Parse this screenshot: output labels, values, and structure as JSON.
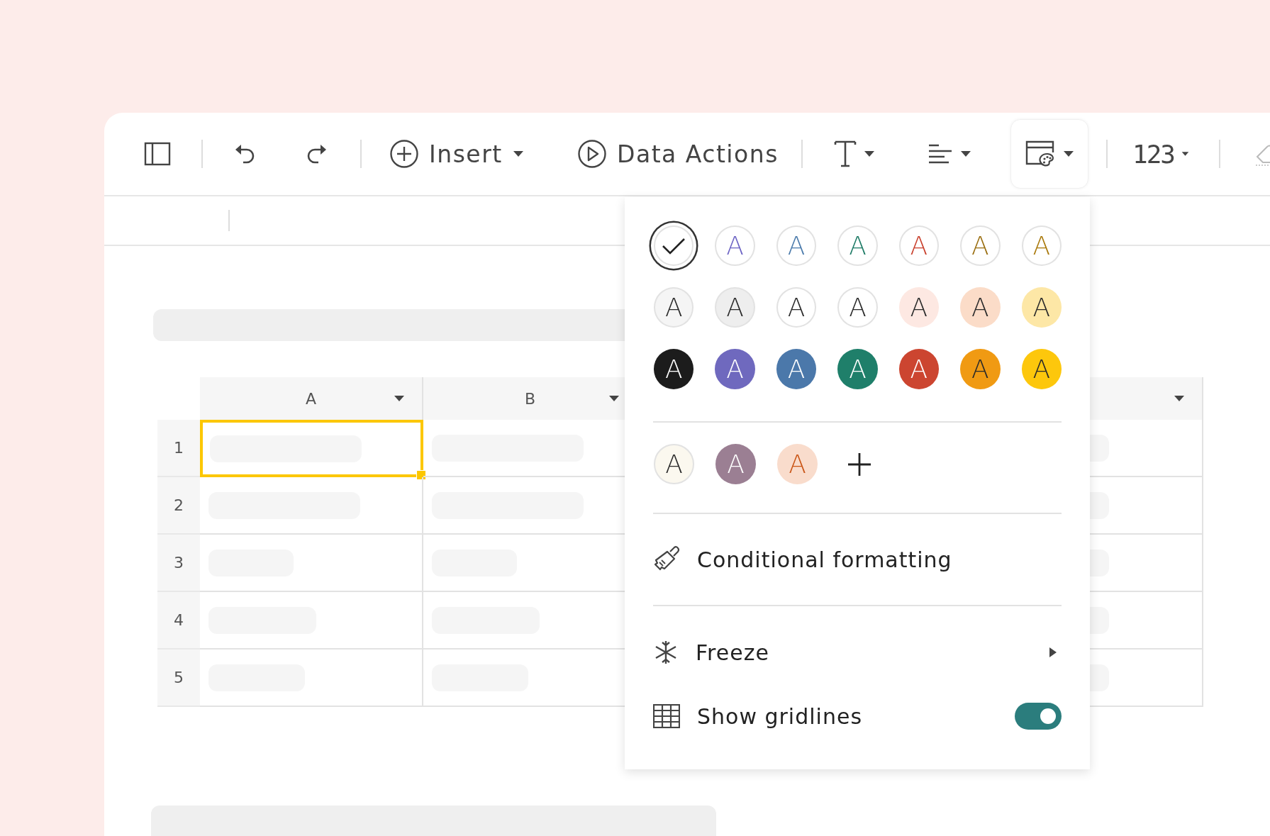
{
  "toolbar": {
    "insert": "Insert",
    "data_actions": "Data Actions",
    "number_format": "123",
    "format_button_selected": true
  },
  "table": {
    "columns": [
      {
        "label": "A"
      },
      {
        "label": "B"
      }
    ],
    "rows": [
      {
        "label": "1",
        "cells": [
          {
            "selected": true
          },
          {
            "selected": false
          },
          {
            "selected": false
          }
        ]
      },
      {
        "label": "2",
        "cells": [
          {
            "selected": false
          },
          {
            "selected": false
          },
          {
            "selected": false
          }
        ]
      },
      {
        "label": "3",
        "cells": [
          {
            "selected": false
          },
          {
            "selected": false
          },
          {
            "selected": false
          }
        ]
      },
      {
        "label": "4",
        "cells": [
          {
            "selected": false
          },
          {
            "selected": false
          },
          {
            "selected": false
          }
        ]
      },
      {
        "label": "5",
        "cells": [
          {
            "selected": false
          },
          {
            "selected": false
          },
          {
            "selected": false
          }
        ]
      }
    ]
  },
  "format_menu": {
    "swatch_rows": [
      [
        {
          "kind": "default",
          "selected": true
        },
        {
          "kind": "outline",
          "label": "A",
          "selected": false,
          "color": "#6c63c4"
        },
        {
          "kind": "outline",
          "label": "A",
          "selected": false,
          "color": "#4a7aab"
        },
        {
          "kind": "outline",
          "label": "A",
          "selected": false,
          "color": "#1e7b66"
        },
        {
          "kind": "outline",
          "label": "A",
          "selected": false,
          "color": "#c9402d"
        },
        {
          "kind": "outline",
          "label": "A",
          "selected": false,
          "color": "#9a6e10"
        },
        {
          "kind": "outline",
          "label": "A",
          "selected": false,
          "color": "#a9780a"
        }
      ],
      [
        {
          "kind": "filled",
          "label": "A",
          "selected": false,
          "color": "#f5f5f5",
          "light_letter": false
        },
        {
          "kind": "filled",
          "label": "A",
          "selected": false,
          "color": "#eeeeee",
          "light_letter": false
        },
        {
          "kind": "filled",
          "label": "A",
          "selected": false,
          "color": "#ffffff",
          "light_letter": false
        },
        {
          "kind": "filled",
          "label": "A",
          "selected": false,
          "color": "#ffffff",
          "light_letter": false
        },
        {
          "kind": "filled",
          "label": "A",
          "selected": false,
          "color": "#fde8e2",
          "light_letter": false
        },
        {
          "kind": "filled",
          "label": "A",
          "selected": false,
          "color": "#fbdcc8",
          "light_letter": false
        },
        {
          "kind": "filled",
          "label": "A",
          "selected": false,
          "color": "#fde7a6",
          "light_letter": false
        }
      ],
      [
        {
          "kind": "filled",
          "label": "A",
          "selected": false,
          "color": "#1c1c1c",
          "light_letter": true
        },
        {
          "kind": "filled",
          "label": "A",
          "selected": false,
          "color": "#6f69be",
          "light_letter": true
        },
        {
          "kind": "filled",
          "label": "A",
          "selected": false,
          "color": "#4b78aa",
          "light_letter": true
        },
        {
          "kind": "filled",
          "label": "A",
          "selected": false,
          "color": "#1f7f6a",
          "light_letter": true
        },
        {
          "kind": "filled",
          "label": "A",
          "selected": false,
          "color": "#cc4530",
          "light_letter": true
        },
        {
          "kind": "filled",
          "label": "A",
          "selected": false,
          "color": "#f09a13",
          "light_letter": false
        },
        {
          "kind": "filled",
          "label": "A",
          "selected": false,
          "color": "#fdc70c",
          "light_letter": false
        }
      ]
    ],
    "custom_swatches": [
      {
        "kind": "filled",
        "label": "A",
        "selected": false,
        "color": "#fbf8ef",
        "light_letter": false
      },
      {
        "kind": "filled",
        "label": "A",
        "selected": false,
        "color": "#9b7f93",
        "light_letter": true
      },
      {
        "kind": "tinted",
        "label": "A",
        "selected": false,
        "color": "#f9dccc"
      },
      {
        "kind": "add",
        "selected": false
      }
    ],
    "items": [
      {
        "kind": "action",
        "label": "Conditional formatting"
      },
      {
        "kind": "submenu",
        "label": "Freeze"
      },
      {
        "kind": "toggle",
        "label": "Show gridlines",
        "on": true
      }
    ]
  }
}
